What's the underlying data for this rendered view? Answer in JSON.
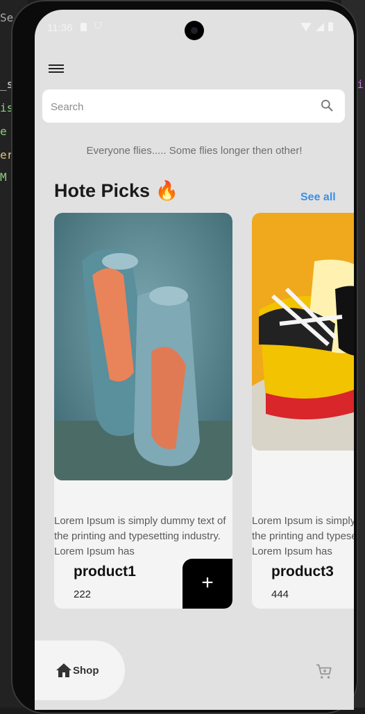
{
  "status_bar": {
    "time": "11:36"
  },
  "search": {
    "placeholder": "Search"
  },
  "tagline": "Everyone flies..... Some flies longer then other!",
  "section": {
    "title": "Hote Picks 🔥",
    "see_all": "See all"
  },
  "products": [
    {
      "name": "product1",
      "price": "222",
      "description": "Lorem Ipsum is simply dummy text of the printing and typesetting industry. Lorem Ipsum has",
      "add_label": "+"
    },
    {
      "name": "product3",
      "price": "444",
      "description": "Lorem Ipsum is simply dummy text of the printing and typesetting industry. Lorem Ipsum has"
    }
  ],
  "bottom_nav": {
    "shop_label": "Shop"
  },
  "colors": {
    "accent": "#3b8fe8",
    "screen_bg": "#e1e1e1",
    "card_bg": "#f4f4f4"
  },
  "icons": [
    "menu-icon",
    "search-icon",
    "home-icon",
    "cart-icon"
  ]
}
